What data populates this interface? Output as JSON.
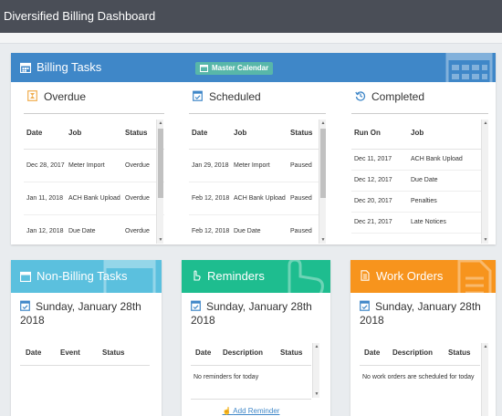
{
  "window": {
    "title": "Diversified Billing Dashboard"
  },
  "billing": {
    "title": "Billing Tasks",
    "master_calendar_label": "Master Calendar",
    "overdue": {
      "title": "Overdue",
      "columns": [
        "Date",
        "Job",
        "Status"
      ],
      "rows": [
        {
          "date": "Dec 28, 2017",
          "job": "Meter Import",
          "status": "Overdue"
        },
        {
          "date": "Jan 11, 2018",
          "job": "ACH Bank Upload",
          "status": "Overdue"
        },
        {
          "date": "Jan 12, 2018",
          "job": "Due Date",
          "status": "Overdue"
        }
      ]
    },
    "scheduled": {
      "title": "Scheduled",
      "columns": [
        "Date",
        "Job",
        "Status"
      ],
      "rows": [
        {
          "date": "Jan 29, 2018",
          "job": "Meter Import",
          "status": "Paused"
        },
        {
          "date": "Feb 12, 2018",
          "job": "ACH Bank Upload",
          "status": "Paused"
        },
        {
          "date": "Feb 12, 2018",
          "job": "Due Date",
          "status": "Paused"
        }
      ]
    },
    "completed": {
      "title": "Completed",
      "columns": [
        "Run On",
        "Job"
      ],
      "rows": [
        {
          "date": "Dec 11, 2017",
          "job": "ACH Bank Upload"
        },
        {
          "date": "Dec 12, 2017",
          "job": "Due Date"
        },
        {
          "date": "Dec 20, 2017",
          "job": "Penalties"
        },
        {
          "date": "Dec 21, 2017",
          "job": "Late Notices"
        }
      ]
    }
  },
  "nonbilling": {
    "title": "Non-Billing Tasks",
    "date": "Sunday, January 28th 2018",
    "columns": [
      "Date",
      "Event",
      "Status"
    ]
  },
  "reminders": {
    "title": "Reminders",
    "date": "Sunday, January 28th 2018",
    "columns": [
      "Date",
      "Description",
      "Status"
    ],
    "empty": "No reminders for today",
    "add_label": "Add Reminder"
  },
  "workorders": {
    "title": "Work Orders",
    "date": "Sunday, January 28th 2018",
    "columns": [
      "Date",
      "Description",
      "Status"
    ],
    "empty": "No work orders are scheduled for today"
  },
  "colors": {
    "billing_header": "#3f87c8",
    "nonbilling_header": "#5bc0de",
    "reminders_header": "#1ebd8f",
    "workorders_header": "#f7941d",
    "master_calendar": "#58b7a9"
  },
  "icons": {
    "billing": "calendar-icon",
    "overdue": "hourglass-icon",
    "scheduled": "calendar-check-icon",
    "completed": "history-icon",
    "reminders": "hand-pointer-icon",
    "workorders": "file-text-icon"
  }
}
